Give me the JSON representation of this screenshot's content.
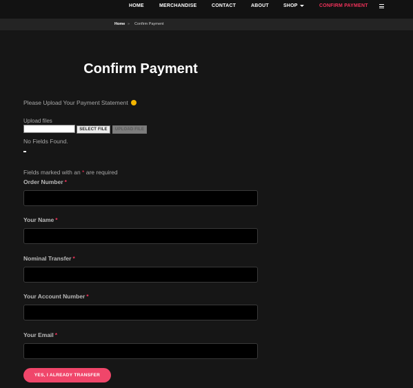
{
  "nav": {
    "items": [
      {
        "label": "HOME"
      },
      {
        "label": "MERCHANDISE"
      },
      {
        "label": "CONTACT"
      },
      {
        "label": "ABOUT"
      },
      {
        "label": "SHOP"
      },
      {
        "label": "CONFIRM PAYMENT"
      }
    ],
    "menu_icon": "hamburger-menu-icon"
  },
  "breadcrumb": {
    "home": "Home",
    "separator": "»",
    "current": "Confirm Payment"
  },
  "page": {
    "title": "Confirm Payment",
    "intro": "Please Upload Your Payment Statement",
    "upload_label": "Upload files",
    "select_button": "SELECT FILE",
    "upload_button": "UPLOAD FILE",
    "no_fields": "No Fields Found.",
    "required_note_prefix": "Fields marked with an",
    "required_note_star": "*",
    "required_note_suffix": "are required"
  },
  "form": {
    "fields": [
      {
        "label": "Order Number",
        "value": ""
      },
      {
        "label": "Your Name",
        "value": ""
      },
      {
        "label": "Nominal Transfer",
        "value": ""
      },
      {
        "label": "Your Account Number",
        "value": ""
      },
      {
        "label": "Your Email",
        "value": ""
      }
    ],
    "required_mark": "*",
    "submit": "YES, I ALREADY TRANSFER"
  },
  "colors": {
    "accent": "#f0325a",
    "button": "#f0466a",
    "background": "#161616"
  }
}
